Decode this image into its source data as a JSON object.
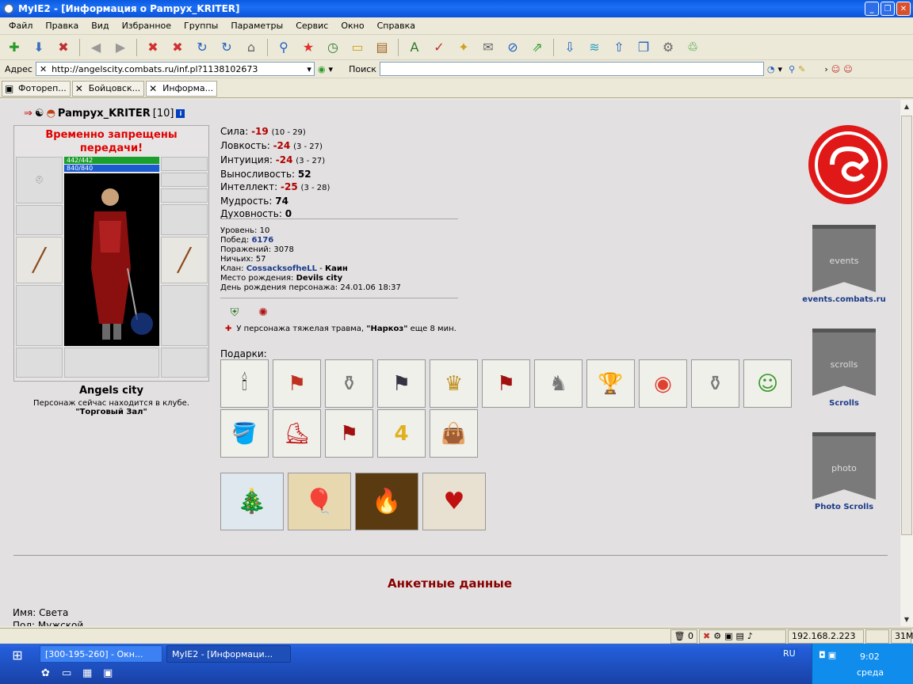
{
  "window": {
    "title": "MyIE2 - [Информация о Pampyx_KRITER]"
  },
  "menu": [
    "Файл",
    "Правка",
    "Вид",
    "Избранное",
    "Группы",
    "Параметры",
    "Сервис",
    "Окно",
    "Справка"
  ],
  "address": {
    "label": "Адрес",
    "url": "http://angelscity.combats.ru/inf.pl?1138102673",
    "search_label": "Поиск"
  },
  "tabs": [
    {
      "label": "Фотореп..."
    },
    {
      "label": "Бойцовск..."
    },
    {
      "label": "Информа..."
    }
  ],
  "character": {
    "name": "Pampyx_KRITER",
    "level_tag": "[10]",
    "warning": "Временно запрещены передачи!",
    "hp": "442/442",
    "mana": "840/840",
    "city": "Angels city",
    "location_text": "Персонаж сейчас находится в клубе.",
    "location_place": "\"Торговый Зал\""
  },
  "stats": [
    {
      "name": "Сила:",
      "value": "-19",
      "range": "(10 - 29)",
      "negative": true
    },
    {
      "name": "Ловкость:",
      "value": "-24",
      "range": "(3 - 27)",
      "negative": true
    },
    {
      "name": "Интуиция:",
      "value": "-24",
      "range": "(3 - 27)",
      "negative": true
    },
    {
      "name": "Выносливость:",
      "value": "52",
      "range": "",
      "negative": false
    },
    {
      "name": "Интеллект:",
      "value": "-25",
      "range": "(3 - 28)",
      "negative": true
    },
    {
      "name": "Мудрость:",
      "value": "74",
      "range": "",
      "negative": false
    },
    {
      "name": "Духовность:",
      "value": "0",
      "range": "",
      "negative": false
    }
  ],
  "info": {
    "level_label": "Уровень:",
    "level": "10",
    "wins_label": "Побед:",
    "wins": "6176",
    "losses_label": "Поражений:",
    "losses": "3078",
    "draws_label": "Ничьих:",
    "draws": "57",
    "clan_label": "Клан:",
    "clan": "CossacksofheLL",
    "clan_sep": " - ",
    "clan_rank": "Каин",
    "birthplace_label": "Место рождения:",
    "birthplace": "Devils city",
    "birthday_label": "День рождения персонажа:",
    "birthday": "24.01.06 18:37"
  },
  "trauma": {
    "prefix": "У персонажа тяжелая травма,",
    "name": "\"Наркоз\"",
    "suffix": "еще 8 мин."
  },
  "gifts": {
    "label": "Подарки:"
  },
  "sidebar": {
    "events_link": "events.combats.ru",
    "events_flag": "events",
    "scrolls_link": "Scrolls",
    "scrolls_flag": "scrolls",
    "photo_link": "Photo Scrolls",
    "photo_flag": "photo"
  },
  "profile": {
    "title": "Анкетные данные",
    "name_label": "Имя:",
    "name": "Света",
    "sex_label": "Пол:",
    "sex": "Мужской"
  },
  "statusbar": {
    "trash": "0",
    "ip": "192.168.2.223",
    "mem": "31M"
  },
  "taskbar": {
    "tasks": [
      {
        "label": "[300-195-260] - Окн..."
      },
      {
        "label": "MyIE2 - [Информаци..."
      }
    ],
    "lang": "RU",
    "time": "9:02",
    "day": "среда"
  }
}
